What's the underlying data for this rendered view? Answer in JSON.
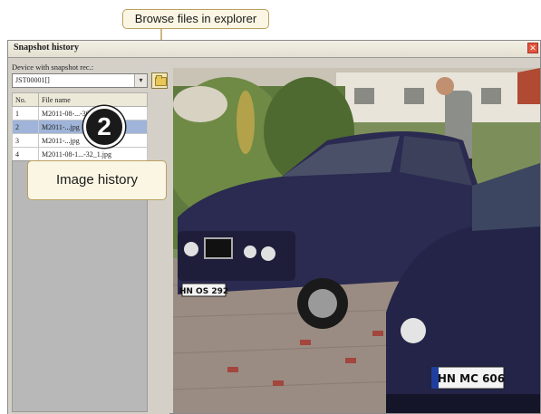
{
  "window": {
    "title": "Snapshot history",
    "close_icon": "close-icon"
  },
  "device": {
    "label": "Device with snapshot rec.:",
    "selected": "JST00001[]",
    "browse_icon": "folder-icon"
  },
  "file_table": {
    "headers": [
      "No.",
      "File name"
    ],
    "rows": [
      {
        "no": "1",
        "name": "M2011-08-...-30.jpg"
      },
      {
        "no": "2",
        "name": "M2011-...jpg"
      },
      {
        "no": "3",
        "name": "M2011-...jpg"
      },
      {
        "no": "4",
        "name": "M2011-08-1...-32_1.jpg"
      }
    ],
    "selected_index": 1
  },
  "callouts": {
    "browse": "Browse files in explorer",
    "history": "Image history",
    "badge": "2"
  },
  "image": {
    "plate_left": "HN OS 292",
    "plate_right": "HN MC 606"
  },
  "colors": {
    "window_bg": "#d4d0c8",
    "callout_border": "#b8a060",
    "selected_row": "#9fb4d8"
  }
}
